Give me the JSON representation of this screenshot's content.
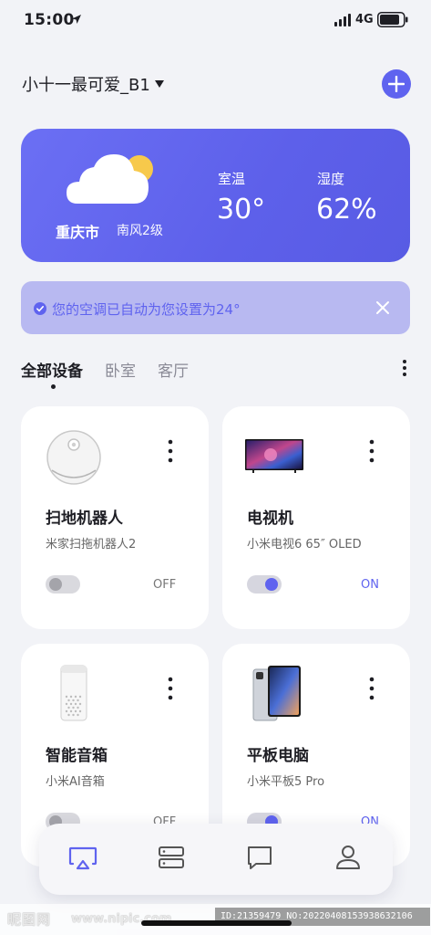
{
  "status_bar": {
    "time": "15:00",
    "network": "4G"
  },
  "header": {
    "home_name": "小十一最可爱_B1"
  },
  "weather": {
    "city": "重庆市",
    "wind": "南风2级",
    "temp_label": "室温",
    "temp_value": "30°",
    "humidity_label": "湿度",
    "humidity_value": "62%"
  },
  "notice": {
    "text": "您的空调已自动为您设置为24°"
  },
  "tabs": [
    {
      "label": "全部设备",
      "active": true
    },
    {
      "label": "卧室",
      "active": false
    },
    {
      "label": "客厅",
      "active": false
    }
  ],
  "devices": [
    {
      "name": "扫地机器人",
      "model": "米家扫拖机器人2",
      "state": "OFF",
      "on": false
    },
    {
      "name": "电视机",
      "model": "小米电视6 65″ OLED",
      "state": "ON",
      "on": true
    },
    {
      "name": "智能音箱",
      "model": "小米AI音箱",
      "state": "OFF",
      "on": false
    },
    {
      "name": "平板电脑",
      "model": "小米平板5 Pro",
      "state": "ON",
      "on": true
    }
  ],
  "bottom_nav": [
    "screen-cast-icon",
    "device-list-icon",
    "chat-icon",
    "user-icon"
  ],
  "watermark": {
    "logo": "昵图网",
    "url": "www.nipic.com",
    "id": "ID:21359479 NO:20220408153938632106"
  },
  "colors": {
    "accent": "#5f63ef",
    "background": "#f2f3f7",
    "notice_bg": "#b8b9f1"
  }
}
